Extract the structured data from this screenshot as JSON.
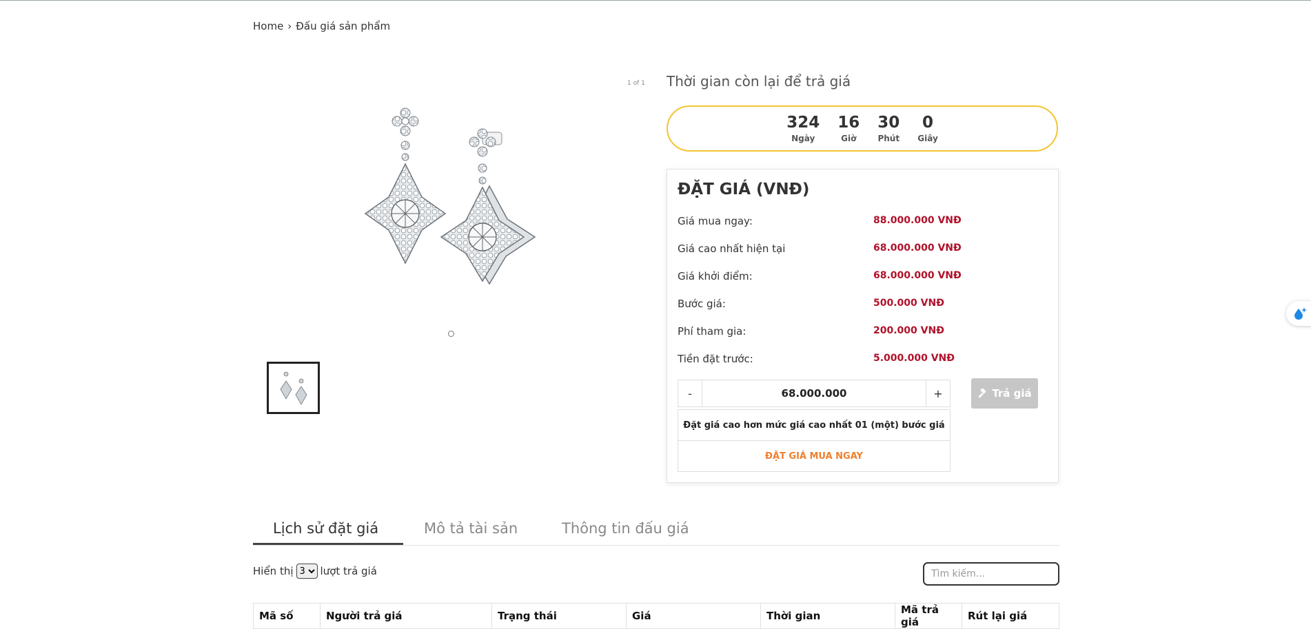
{
  "breadcrumb": {
    "home": "Home",
    "current": "Đấu giá sản phẩm"
  },
  "gallery": {
    "counter": "1 of 1"
  },
  "countdown": {
    "title": "Thời gian còn lại để trả giá",
    "days": "324",
    "days_label": "Ngày",
    "hours": "16",
    "hours_label": "Giờ",
    "minutes": "30",
    "minutes_label": "Phút",
    "seconds": "0",
    "seconds_label": "Giây",
    "border_color": "#f4c430"
  },
  "bid": {
    "title": "ĐẶT GIÁ (VNĐ)",
    "rows": [
      {
        "label": "Giá mua ngay:",
        "value": "88.000.000 VNĐ"
      },
      {
        "label": "Giá cao nhất hiện tại",
        "value": "68.000.000 VNĐ"
      },
      {
        "label": "Giá khởi điểm:",
        "value": "68.000.000 VNĐ"
      },
      {
        "label": "Bước giá:",
        "value": "500.000 VNĐ"
      },
      {
        "label": "Phí tham gia:",
        "value": "200.000 VNĐ"
      },
      {
        "label": "Tiền đặt trước:",
        "value": "5.000.000 VNĐ"
      }
    ],
    "minus": "-",
    "plus": "+",
    "amount": "68.000.000",
    "submit_label": "Trả giá",
    "note": "Đặt giá cao hơn mức giá cao nhất 01 (một) bước giá",
    "buy_now": "ĐẶT GIÁ MUA NGAY",
    "value_color": "#b0122b",
    "buy_now_color": "#f07f2d"
  },
  "tabs": [
    {
      "label": "Lịch sử đặt giá",
      "active": true
    },
    {
      "label": "Mô tả tài sản",
      "active": false
    },
    {
      "label": "Thông tin đấu giá",
      "active": false
    }
  ],
  "history": {
    "show_prefix": "Hiển thị",
    "show_value": "3",
    "show_suffix": "lượt trả giá",
    "search_placeholder": "Tìm kiếm...",
    "columns": [
      "Mã số",
      "Người trả giá",
      "Trạng thái",
      "Giá",
      "Thời gian",
      "Mã trả giá",
      "Rút lại giá"
    ]
  }
}
